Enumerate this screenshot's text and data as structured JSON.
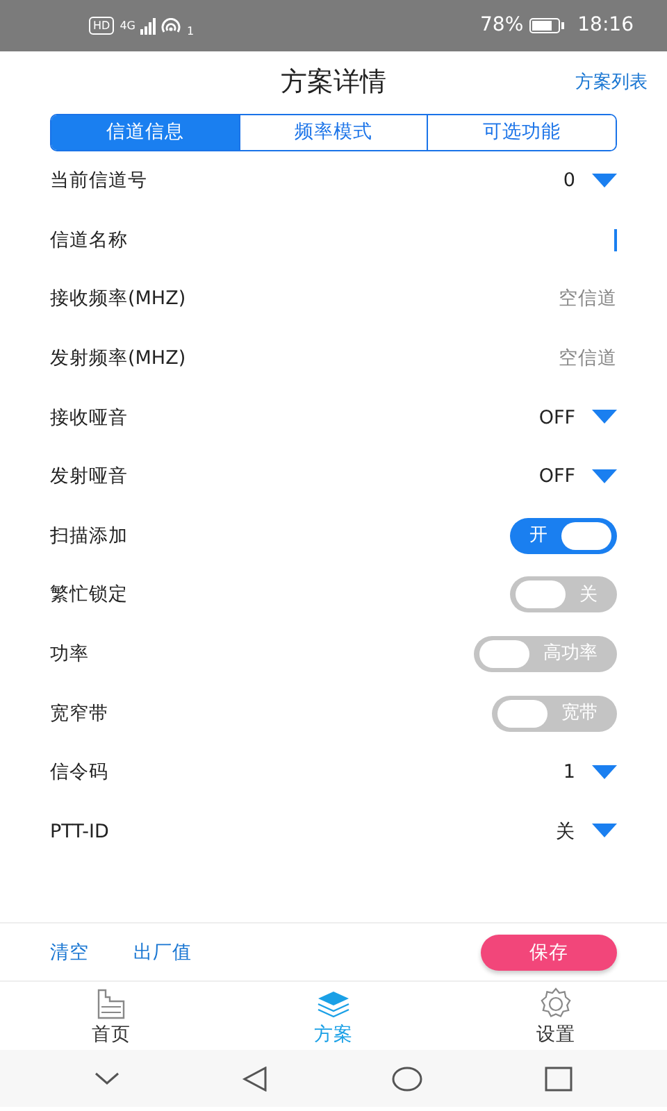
{
  "status_bar": {
    "hd": "HD",
    "network": "4G",
    "hotspot_count": "1",
    "battery": "78%",
    "time": "18:16"
  },
  "header": {
    "title": "方案详情",
    "action": "方案列表"
  },
  "tabs": [
    {
      "label": "信道信息",
      "selected": true
    },
    {
      "label": "频率模式",
      "selected": false
    },
    {
      "label": "可选功能",
      "selected": false
    }
  ],
  "rows": [
    {
      "kind": "dropdown",
      "label": "当前信道号",
      "value": "0"
    },
    {
      "kind": "input",
      "label": "信道名称"
    },
    {
      "kind": "text",
      "label": "接收频率(MHZ)",
      "placeholder": "空信道"
    },
    {
      "kind": "text",
      "label": "发射频率(MHZ)",
      "placeholder": "空信道"
    },
    {
      "kind": "dropdown",
      "label": "接收哑音",
      "value": "OFF"
    },
    {
      "kind": "dropdown",
      "label": "发射哑音",
      "value": "OFF"
    },
    {
      "kind": "toggle",
      "label": "扫描添加",
      "value": "开",
      "on": true
    },
    {
      "kind": "toggle",
      "label": "繁忙锁定",
      "value": "关",
      "on": false
    },
    {
      "kind": "toggle",
      "label": "功率",
      "value": "高功率",
      "on": false
    },
    {
      "kind": "toggle",
      "label": "宽窄带",
      "value": "宽带",
      "on": false
    },
    {
      "kind": "dropdown",
      "label": "信令码",
      "value": "1"
    },
    {
      "kind": "dropdown",
      "label": "PTT-ID",
      "value": "关"
    }
  ],
  "actions": {
    "clear": "清空",
    "factory": "出厂值",
    "save": "保存"
  },
  "bottom_nav": [
    {
      "label": "首页",
      "kind": "home",
      "selected": false
    },
    {
      "label": "方案",
      "kind": "layers",
      "selected": true
    },
    {
      "label": "设置",
      "kind": "gear",
      "selected": false
    }
  ]
}
